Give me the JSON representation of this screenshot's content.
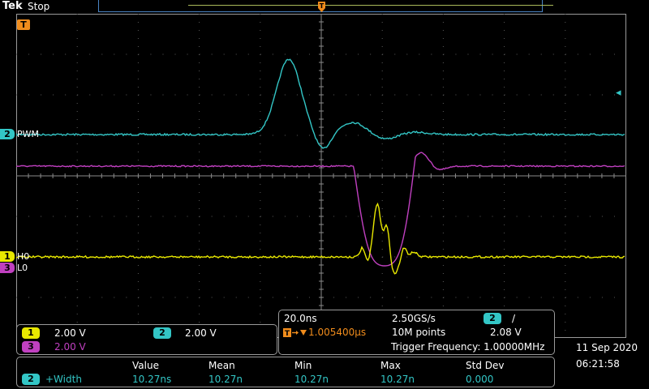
{
  "header": {
    "brand": "Tek",
    "status": "Stop"
  },
  "markers": {
    "trigger_position": "T",
    "trigger_level_arrow": "◂"
  },
  "channels": [
    {
      "id": "1",
      "label": "H0",
      "color": "#e8e800",
      "scale": "2.00 V"
    },
    {
      "id": "2",
      "label": "PWM",
      "color": "#33c6c6",
      "scale": "2.00 V"
    },
    {
      "id": "3",
      "label": "L0",
      "color": "#c040c0",
      "scale": "2.00 V"
    }
  ],
  "horizontal": {
    "timebase": "20.0ns",
    "delay": "1.005400μs",
    "sample_rate": "2.50GS/s",
    "record_length": "10M points"
  },
  "trigger": {
    "source": "2",
    "slope": "/",
    "level": "2.08 V",
    "frequency": "Trigger Frequency: 1.00000MHz"
  },
  "measurement": {
    "headers": [
      "Value",
      "Mean",
      "Min",
      "Max",
      "Std Dev"
    ],
    "source": "2",
    "name": "+Width",
    "values": [
      "10.27ns",
      "10.27n",
      "10.27n",
      "10.27n",
      "0.000"
    ]
  },
  "clock": {
    "date": "11 Sep 2020",
    "time": "06:21:58"
  },
  "colors": {
    "grid": "#5a5a5a",
    "frame": "#9a9a9a",
    "accent_orange": "#f08c1c"
  }
}
